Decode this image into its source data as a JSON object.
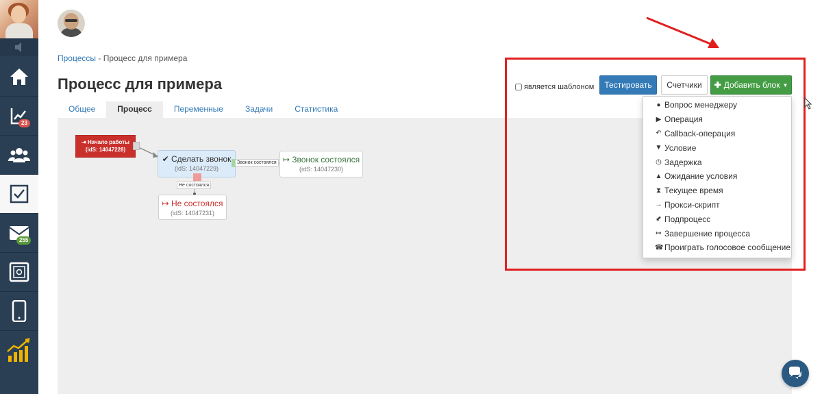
{
  "sidebar": {
    "badges": {
      "analytics": "23",
      "mail": "255"
    }
  },
  "breadcrumb": {
    "parent": "Процессы",
    "separator": "-",
    "current": "Процесс для примера"
  },
  "page": {
    "title": "Процесс для примера"
  },
  "tabs": [
    {
      "label": "Общее",
      "active": false
    },
    {
      "label": "Процесс",
      "active": true
    },
    {
      "label": "Переменные",
      "active": false
    },
    {
      "label": "Задачи",
      "active": false
    },
    {
      "label": "Статистика",
      "active": false
    }
  ],
  "toolbar": {
    "template_label": "является шаблоном",
    "template_checked": false,
    "test_label": "Тестировать",
    "counters_label": "Счетчики",
    "add_block_label": "Добавить блок"
  },
  "add_block_menu": [
    {
      "icon": "user-icon",
      "glyph": "👤",
      "label": "Вопрос менеджеру"
    },
    {
      "icon": "play-icon",
      "glyph": "▶",
      "label": "Операция"
    },
    {
      "icon": "reply-icon",
      "glyph": "↶",
      "label": "Callback-операция"
    },
    {
      "icon": "filter-icon",
      "glyph": "▼",
      "label": "Условие"
    },
    {
      "icon": "clock-icon",
      "glyph": "◷",
      "label": "Задержка"
    },
    {
      "icon": "bell-icon",
      "glyph": "🔔",
      "label": "Ожидание условия"
    },
    {
      "icon": "hourglass-icon",
      "glyph": "⧗",
      "label": "Текущее время"
    },
    {
      "icon": "arrow-right-icon",
      "glyph": "⟶",
      "label": "Прокси-скрипт"
    },
    {
      "icon": "plug-icon",
      "glyph": "🔌",
      "label": "Подпроцесс"
    },
    {
      "icon": "sign-out-icon",
      "glyph": "↦",
      "label": "Завершение процесса"
    },
    {
      "icon": "phone-icon",
      "glyph": "☎",
      "label": "Проиграть голосовое сообщение"
    }
  ],
  "process": {
    "start": {
      "title": "Начало работы",
      "id": "(idS: 14047228)"
    },
    "call": {
      "title": "Сделать звонок",
      "id": "(idS: 14047229)"
    },
    "success": {
      "title": "Звонок состоялся",
      "id": "(idS: 14047230)"
    },
    "fail": {
      "title": "Не состоялся",
      "id": "(idS: 14047231)"
    },
    "link_success": "Звонок состоялся",
    "link_fail": "Не состоялся"
  },
  "colors": {
    "sidebar_bg": "#2a3f54",
    "primary": "#337ab7",
    "success": "#449d44",
    "danger": "#c9302c",
    "annotation": "#e11f1f"
  }
}
